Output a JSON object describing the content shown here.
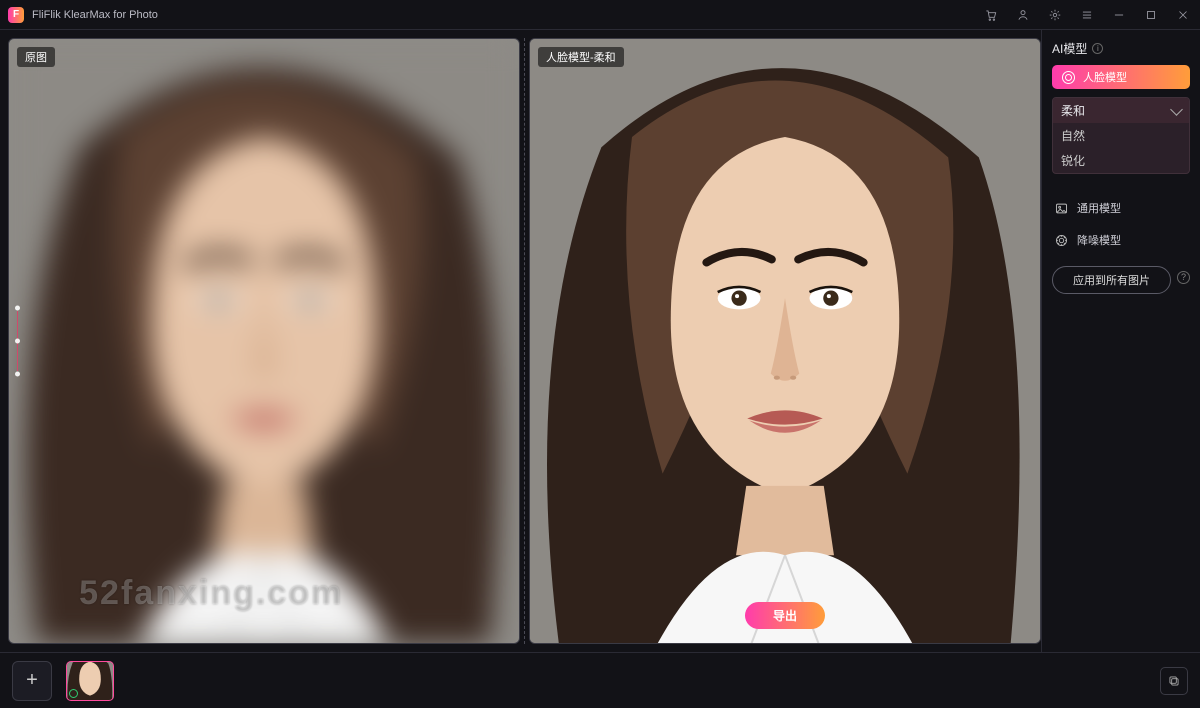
{
  "app": {
    "title": "FliFlik KlearMax for Photo",
    "logo_letter": "F"
  },
  "titlebar_icons": [
    "cart",
    "user",
    "gear",
    "menu",
    "minimize",
    "maximize",
    "close"
  ],
  "preview": {
    "left_label": "原图",
    "right_label": "人脸模型-柔和",
    "export_label": "导出",
    "watermark": "52fanxing.com"
  },
  "sidepanel": {
    "title": "AI模型",
    "face_model_label": "人脸模型",
    "dropdown": {
      "selected": "柔和",
      "options": [
        "自然",
        "锐化"
      ]
    },
    "general_model_label": "通用模型",
    "denoise_model_label": "降噪模型",
    "apply_all_label": "应用到所有图片"
  },
  "bottombar": {
    "add_tooltip": "+"
  }
}
